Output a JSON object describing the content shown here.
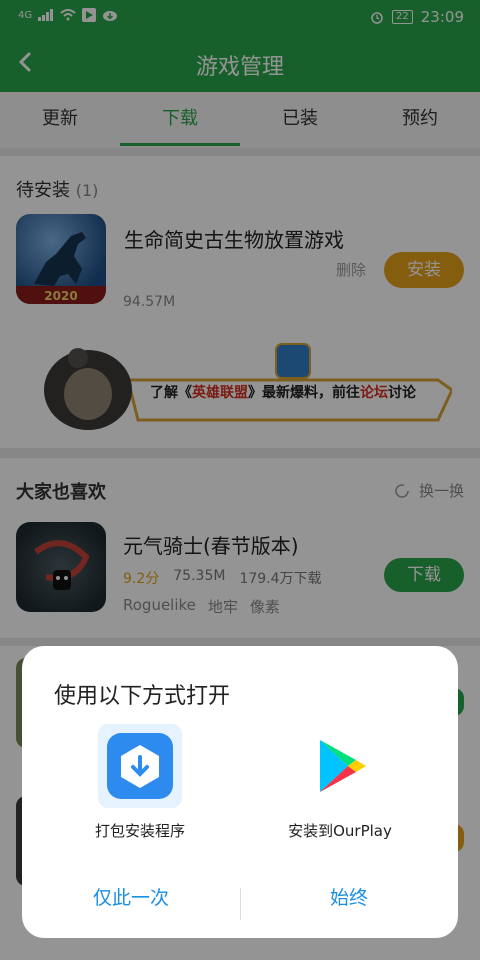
{
  "status": {
    "net": "4G",
    "battery": "22",
    "time": "23:09"
  },
  "appbar": {
    "title": "游戏管理"
  },
  "tabs": [
    {
      "label": "更新",
      "active": false
    },
    {
      "label": "下载",
      "active": true
    },
    {
      "label": "已装",
      "active": false
    },
    {
      "label": "预约",
      "active": false
    }
  ],
  "pending": {
    "title": "待安装",
    "count": "(1)",
    "app": {
      "name": "生命简史古生物放置游戏",
      "size": "94.57M",
      "delete_label": "删除",
      "install_label": "安装",
      "icon_text": "2020"
    }
  },
  "banner": {
    "text_prefix": "了解《",
    "text_highlight1": "英雄联盟",
    "text_middle": "》最新爆料，前往",
    "text_highlight2": "论坛",
    "text_suffix": "讨论"
  },
  "recommend": {
    "title": "大家也喜欢",
    "refresh_label": "换一换",
    "app": {
      "name": "元气骑士(春节版本)",
      "score": "9.2分",
      "size": "75.35M",
      "downloads": "179.4万下载",
      "tags": [
        "Roguelike",
        "地牢",
        "像素"
      ],
      "download_label": "下载"
    }
  },
  "dialog": {
    "title": "使用以下方式打开",
    "options": [
      {
        "label": "打包安装程序"
      },
      {
        "label": "安装到OurPlay"
      }
    ],
    "once_label": "仅此一次",
    "always_label": "始终"
  },
  "colors": {
    "primary": "#2aa64a",
    "accent": "#e6a019",
    "link": "#1a8fe3"
  }
}
